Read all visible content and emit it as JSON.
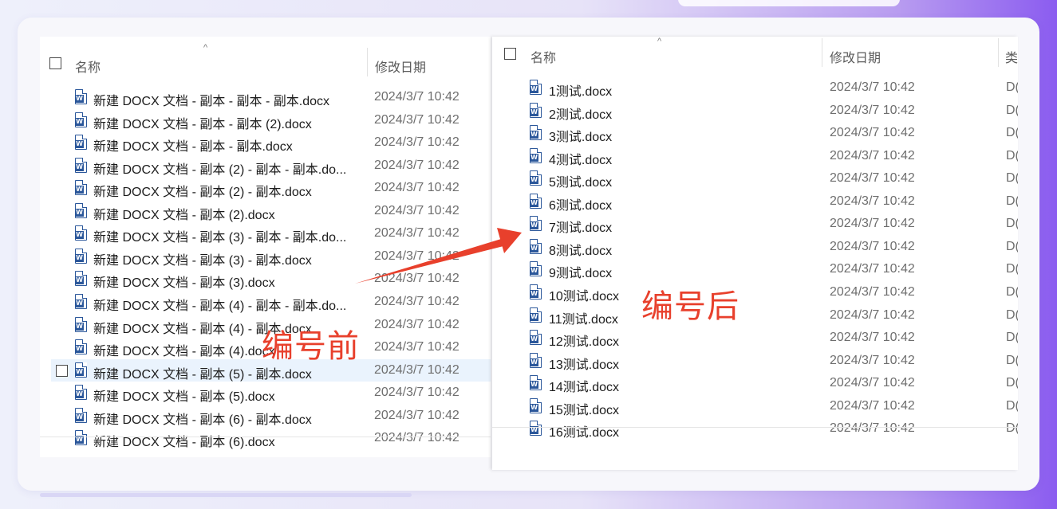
{
  "annotations": {
    "before_label": "编号前",
    "after_label": "编号后",
    "accent_color": "#e8402c"
  },
  "left_pane": {
    "columns": {
      "name": "名称",
      "date": "修改日期"
    },
    "sort_indicator": "^",
    "rows": [
      {
        "name": "新建 DOCX 文档 - 副本 - 副本 - 副本.docx",
        "date": "2024/3/7 10:42"
      },
      {
        "name": "新建 DOCX 文档 - 副本 - 副本 (2).docx",
        "date": "2024/3/7 10:42"
      },
      {
        "name": "新建 DOCX 文档 - 副本 - 副本.docx",
        "date": "2024/3/7 10:42"
      },
      {
        "name": "新建 DOCX 文档 - 副本 (2) - 副本 - 副本.do...",
        "date": "2024/3/7 10:42"
      },
      {
        "name": "新建 DOCX 文档 - 副本 (2) - 副本.docx",
        "date": "2024/3/7 10:42"
      },
      {
        "name": "新建 DOCX 文档 - 副本 (2).docx",
        "date": "2024/3/7 10:42"
      },
      {
        "name": "新建 DOCX 文档 - 副本 (3) - 副本 - 副本.do...",
        "date": "2024/3/7 10:42"
      },
      {
        "name": "新建 DOCX 文档 - 副本 (3) - 副本.docx",
        "date": "2024/3/7 10:42"
      },
      {
        "name": "新建 DOCX 文档 - 副本 (3).docx",
        "date": "2024/3/7 10:42"
      },
      {
        "name": "新建 DOCX 文档 - 副本 (4) - 副本 - 副本.do...",
        "date": "2024/3/7 10:42"
      },
      {
        "name": "新建 DOCX 文档 - 副本 (4) - 副本.docx",
        "date": "2024/3/7 10:42"
      },
      {
        "name": "新建 DOCX 文档 - 副本 (4).docx",
        "date": "2024/3/7 10:42"
      },
      {
        "name": "新建 DOCX 文档 - 副本 (5) - 副本.docx",
        "date": "2024/3/7 10:42"
      },
      {
        "name": "新建 DOCX 文档 - 副本 (5).docx",
        "date": "2024/3/7 10:42"
      },
      {
        "name": "新建 DOCX 文档 - 副本 (6) - 副本.docx",
        "date": "2024/3/7 10:42"
      },
      {
        "name": "新建 DOCX 文档 - 副本 (6).docx",
        "date": "2024/3/7 10:42"
      }
    ]
  },
  "right_pane": {
    "columns": {
      "name": "名称",
      "date": "修改日期",
      "type": "类"
    },
    "sort_indicator": "^",
    "rows": [
      {
        "name": "1测试.docx",
        "date": "2024/3/7 10:42",
        "type": "D("
      },
      {
        "name": "2测试.docx",
        "date": "2024/3/7 10:42",
        "type": "D("
      },
      {
        "name": "3测试.docx",
        "date": "2024/3/7 10:42",
        "type": "D("
      },
      {
        "name": "4测试.docx",
        "date": "2024/3/7 10:42",
        "type": "D("
      },
      {
        "name": "5测试.docx",
        "date": "2024/3/7 10:42",
        "type": "D("
      },
      {
        "name": "6测试.docx",
        "date": "2024/3/7 10:42",
        "type": "D("
      },
      {
        "name": "7测试.docx",
        "date": "2024/3/7 10:42",
        "type": "D("
      },
      {
        "name": "8测试.docx",
        "date": "2024/3/7 10:42",
        "type": "D("
      },
      {
        "name": "9测试.docx",
        "date": "2024/3/7 10:42",
        "type": "D("
      },
      {
        "name": "10测试.docx",
        "date": "2024/3/7 10:42",
        "type": "D("
      },
      {
        "name": "11测试.docx",
        "date": "2024/3/7 10:42",
        "type": "D("
      },
      {
        "name": "12测试.docx",
        "date": "2024/3/7 10:42",
        "type": "D("
      },
      {
        "name": "13测试.docx",
        "date": "2024/3/7 10:42",
        "type": "D("
      },
      {
        "name": "14测试.docx",
        "date": "2024/3/7 10:42",
        "type": "D("
      },
      {
        "name": "15测试.docx",
        "date": "2024/3/7 10:42",
        "type": "D("
      },
      {
        "name": "16测试.docx",
        "date": "2024/3/7 10:42",
        "type": "D("
      }
    ]
  },
  "icons": {
    "file_icon": "word-docx-icon",
    "file_icon_letter": "W"
  }
}
